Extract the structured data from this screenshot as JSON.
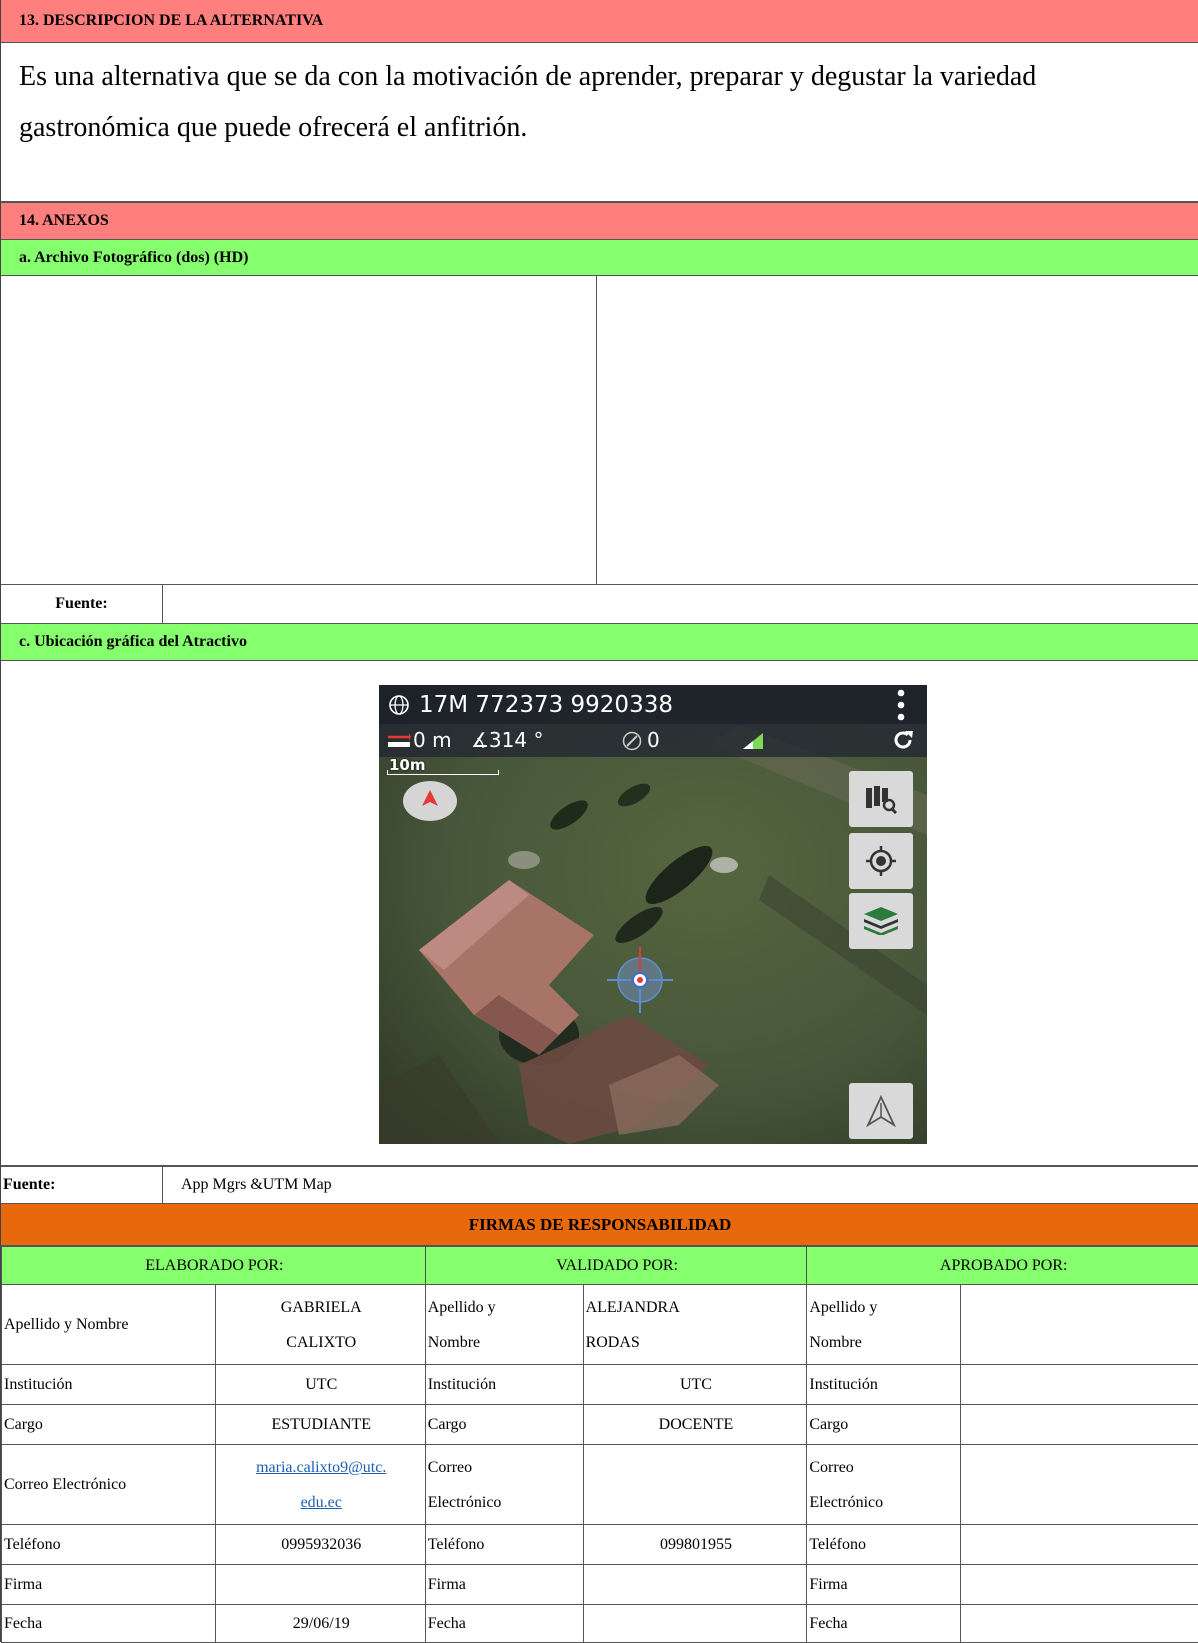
{
  "section13": {
    "title": "13. DESCRIPCION DE LA ALTERNATIVA",
    "text": "Es una alternativa que se da con la motivación de aprender, preparar y degustar la variedad gastronómica que puede ofrecerá el anfitrión."
  },
  "section14": {
    "title": "14. ANEXOS",
    "photo_header": "a. Archivo Fotográfico (dos) (HD)",
    "photo_fuente_label": "Fuente:",
    "photo_fuente_value": "",
    "location_header": "c. Ubicación gráfica del Atractivo",
    "location_fuente_label": "Fuente:",
    "location_fuente_value": "App Mgrs &UTM Map"
  },
  "map": {
    "coordinates": "17M 772373 9920338",
    "distance": "0 m",
    "angle": "∡314 °",
    "satellites": "0",
    "scale": "10m",
    "icons": [
      "globe-icon",
      "menu-dots-icon",
      "ruler-icon",
      "compass-icon",
      "signal-icon",
      "refresh-icon",
      "compass-north-icon",
      "map-search-icon",
      "locate-icon",
      "layers-icon",
      "navigate-icon",
      "crosshair-icon"
    ]
  },
  "signatures": {
    "title": "FIRMAS DE RESPONSABILIDAD",
    "col1_header": "ELABORADO POR:",
    "col2_header": "VALIDADO  POR:",
    "col3_header": "APROBADO POR:",
    "labels": {
      "name_full": "Apellido y Nombre",
      "name_line1": "Apellido y",
      "name_line2": "Nombre",
      "institution": "Institución",
      "position": "Cargo",
      "email_full": "Correo Electrónico",
      "email_line1": "Correo",
      "email_line2": "Electrónico",
      "phone": "Teléfono",
      "signature": "Firma",
      "date": "Fecha"
    },
    "elaborado": {
      "name_line1": "GABRIELA",
      "name_line2": "CALIXTO",
      "institution": "UTC",
      "position": "ESTUDIANTE",
      "email_line1": "maria.calixto9@utc.",
      "email_line2": "edu.ec",
      "phone": "0995932036",
      "signature": "",
      "date": "29/06/19"
    },
    "validado": {
      "name_line1": "ALEJANDRA",
      "name_line2": "RODAS",
      "institution": "UTC",
      "position": "DOCENTE",
      "email": "",
      "phone": "099801955",
      "signature": "",
      "date": ""
    }
  }
}
